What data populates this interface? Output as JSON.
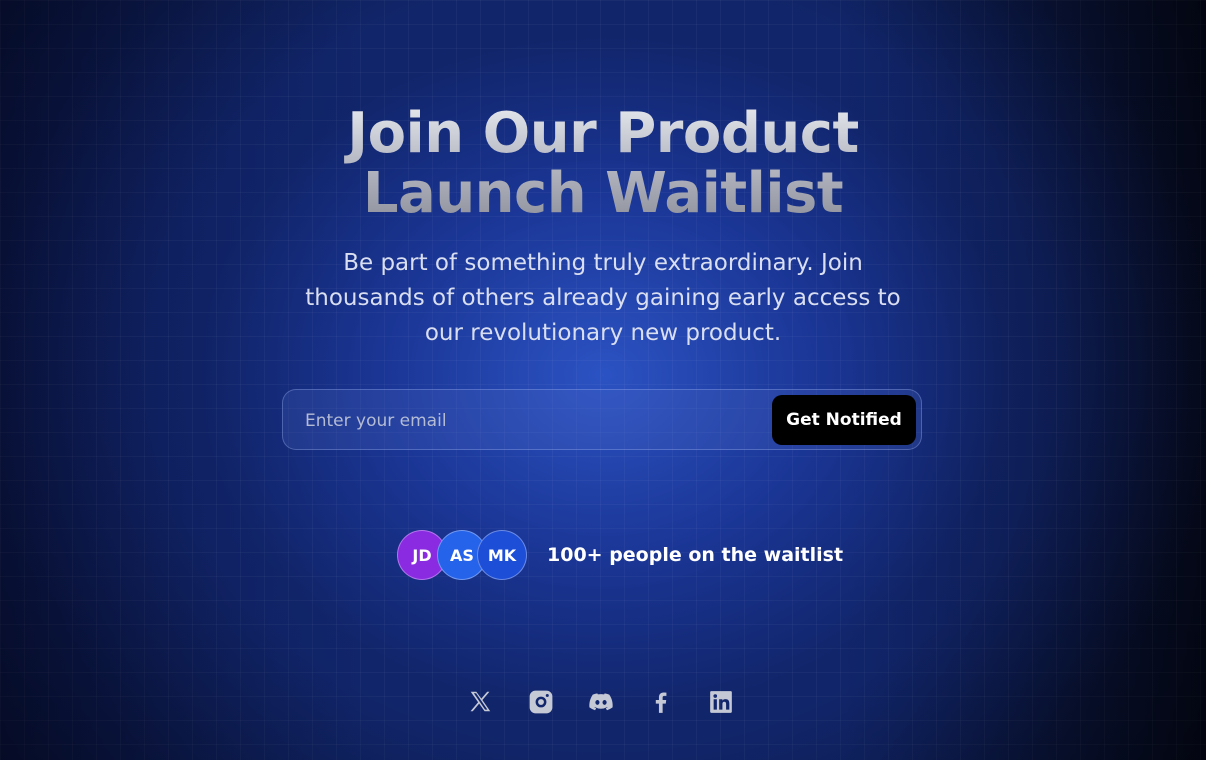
{
  "hero": {
    "title_line1": "Join Our Product",
    "title_line2": "Launch Waitlist",
    "subtitle": "Be part of something truly extraordinary. Join thousands of others already gaining early access to our revolutionary new product."
  },
  "signup": {
    "email_placeholder": "Enter your email",
    "button_label": "Get Notified"
  },
  "waitlist": {
    "avatars": [
      {
        "initials": "JD",
        "color": "#8a2be2"
      },
      {
        "initials": "AS",
        "color": "#2563eb"
      },
      {
        "initials": "MK",
        "color": "#1d4ed8"
      }
    ],
    "count_text": "100+ people on the waitlist"
  },
  "socials": [
    {
      "icon": "x-twitter-icon"
    },
    {
      "icon": "instagram-icon"
    },
    {
      "icon": "discord-icon"
    },
    {
      "icon": "facebook-icon"
    },
    {
      "icon": "linkedin-icon"
    }
  ],
  "colors": {
    "background_deep": "#0d1c58",
    "background_glow": "#2d55c8",
    "button_bg": "#000000",
    "icon_color": "#c5c9d6"
  }
}
